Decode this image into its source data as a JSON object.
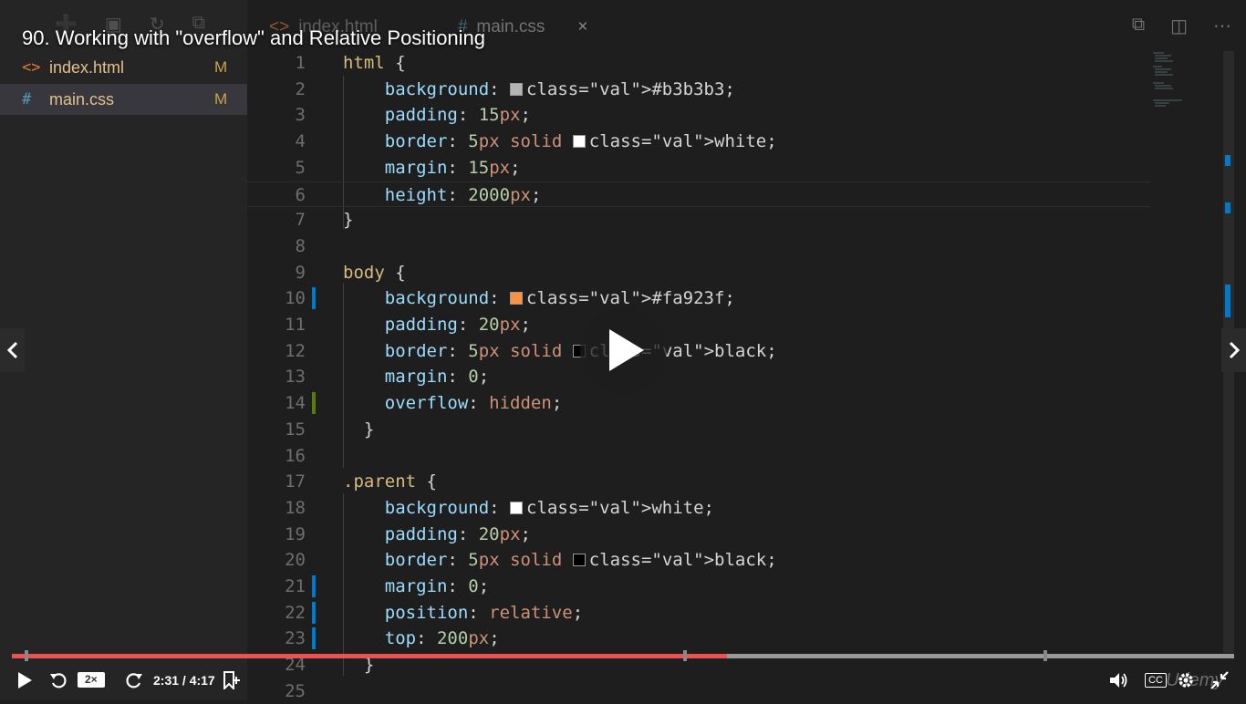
{
  "video": {
    "title": "90. Working with \"overflow\" and Relative Positioning",
    "current_time": "2:31",
    "duration": "4:17",
    "time_display": "2:31 / 4:17",
    "speed": "2×",
    "progress": 0.585,
    "brand": "Udemy",
    "cc_label": "CC"
  },
  "explorer": {
    "files": [
      {
        "icon": "<>",
        "name": "index.html",
        "status": "M",
        "active": false
      },
      {
        "icon": "#",
        "name": "main.css",
        "status": "M",
        "active": true
      }
    ]
  },
  "tabs": [
    {
      "icon": "<>",
      "label": "index.html"
    },
    {
      "icon": "#",
      "label": "main.css",
      "close": "×"
    }
  ],
  "editor": {
    "lines": [
      {
        "n": "1",
        "text": "html {"
      },
      {
        "n": "2",
        "text": "    background: #b3b3b3;",
        "swatch": "#b3b3b3"
      },
      {
        "n": "3",
        "text": "    padding: 15px;"
      },
      {
        "n": "4",
        "text": "    border: 5px solid white;",
        "swatch": "#ffffff"
      },
      {
        "n": "5",
        "text": "    margin: 15px;"
      },
      {
        "n": "6",
        "text": "    height: 2000px;"
      },
      {
        "n": "7",
        "text": "}"
      },
      {
        "n": "8",
        "text": ""
      },
      {
        "n": "9",
        "text": "body {"
      },
      {
        "n": "10",
        "text": "    background: #fa923f;",
        "swatch": "#fa923f"
      },
      {
        "n": "11",
        "text": "    padding: 20px;"
      },
      {
        "n": "12",
        "text": "    border: 5px solid black;",
        "swatch": "#000000"
      },
      {
        "n": "13",
        "text": "    margin: 0;"
      },
      {
        "n": "14",
        "text": "    overflow: hidden;"
      },
      {
        "n": "15",
        "text": "  }"
      },
      {
        "n": "16",
        "text": ""
      },
      {
        "n": "17",
        "text": ".parent {"
      },
      {
        "n": "18",
        "text": "    background: white;",
        "swatch": "#ffffff"
      },
      {
        "n": "19",
        "text": "    padding: 20px;"
      },
      {
        "n": "20",
        "text": "    border: 5px solid black;",
        "swatch": "#000000"
      },
      {
        "n": "21",
        "text": "    margin: 0;"
      },
      {
        "n": "22",
        "text": "    position: relative;"
      },
      {
        "n": "23",
        "text": "    top: 200px;"
      },
      {
        "n": "24",
        "text": "  }"
      },
      {
        "n": "25",
        "text": ""
      }
    ]
  },
  "colors": {
    "accent": "#ec5252",
    "modified_blue": "#007acc",
    "added_green": "#587c0c"
  }
}
